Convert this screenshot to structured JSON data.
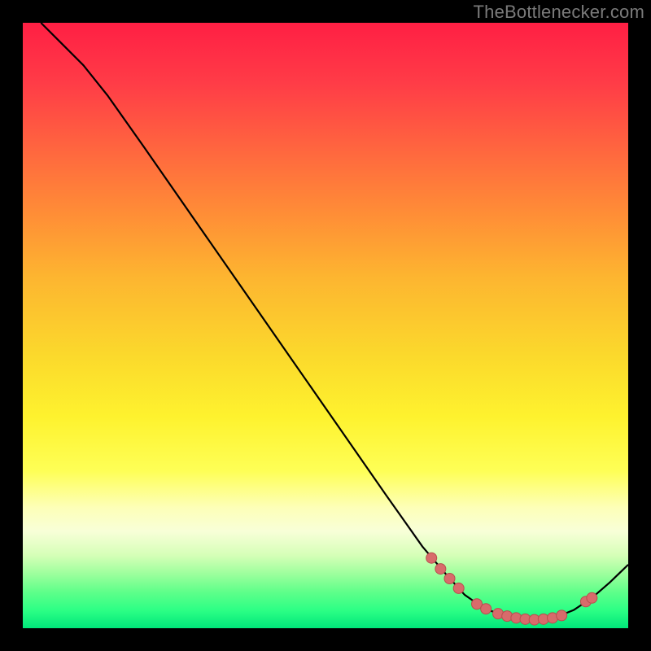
{
  "attribution": "TheBottlenecker.com",
  "chart_data": {
    "type": "line",
    "title": "",
    "xlabel": "",
    "ylabel": "",
    "xlim": [
      0,
      100
    ],
    "ylim": [
      0,
      100
    ],
    "curve_points": [
      {
        "x": 3,
        "y": 100
      },
      {
        "x": 6,
        "y": 97
      },
      {
        "x": 10,
        "y": 93
      },
      {
        "x": 14,
        "y": 88
      },
      {
        "x": 20,
        "y": 79.5
      },
      {
        "x": 28,
        "y": 68
      },
      {
        "x": 36,
        "y": 56.5
      },
      {
        "x": 44,
        "y": 45
      },
      {
        "x": 52,
        "y": 33.5
      },
      {
        "x": 60,
        "y": 22
      },
      {
        "x": 66,
        "y": 13.5
      },
      {
        "x": 70,
        "y": 8.8
      },
      {
        "x": 73,
        "y": 5.5
      },
      {
        "x": 76,
        "y": 3.4
      },
      {
        "x": 79,
        "y": 2.2
      },
      {
        "x": 82,
        "y": 1.6
      },
      {
        "x": 85,
        "y": 1.4
      },
      {
        "x": 88,
        "y": 1.8
      },
      {
        "x": 91,
        "y": 3.0
      },
      {
        "x": 94,
        "y": 5.0
      },
      {
        "x": 97,
        "y": 7.6
      },
      {
        "x": 100,
        "y": 10.5
      }
    ],
    "highlight_points": [
      {
        "x": 67.5,
        "y": 11.6
      },
      {
        "x": 69.0,
        "y": 9.8
      },
      {
        "x": 70.5,
        "y": 8.2
      },
      {
        "x": 72.0,
        "y": 6.6
      },
      {
        "x": 75.0,
        "y": 4.0
      },
      {
        "x": 76.5,
        "y": 3.2
      },
      {
        "x": 78.5,
        "y": 2.4
      },
      {
        "x": 80.0,
        "y": 2.0
      },
      {
        "x": 81.5,
        "y": 1.7
      },
      {
        "x": 83.0,
        "y": 1.5
      },
      {
        "x": 84.5,
        "y": 1.4
      },
      {
        "x": 86.0,
        "y": 1.5
      },
      {
        "x": 87.5,
        "y": 1.7
      },
      {
        "x": 89.0,
        "y": 2.1
      },
      {
        "x": 93.0,
        "y": 4.4
      },
      {
        "x": 94.0,
        "y": 5.0
      }
    ],
    "colors": {
      "curve": "#000000",
      "dot_fill": "#d86b6b",
      "dot_stroke": "#b94e4e",
      "gradient_top": "#ff1f44",
      "gradient_bottom": "#00e77a"
    }
  }
}
